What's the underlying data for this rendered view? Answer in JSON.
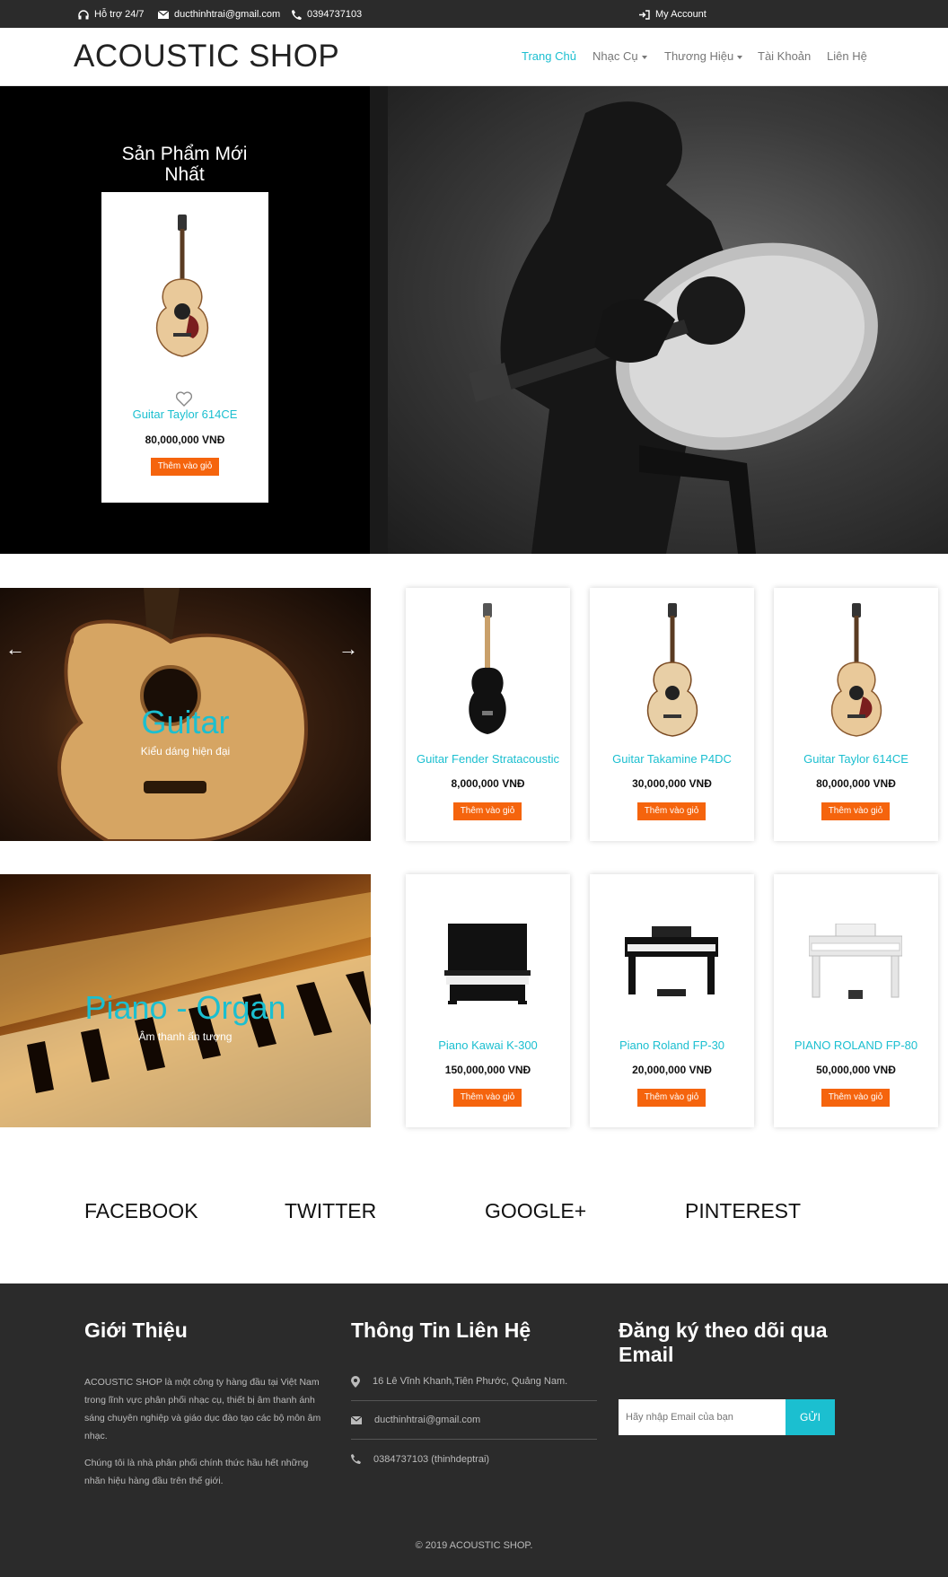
{
  "topbar": {
    "support": "Hỗ trợ 24/7",
    "email": "ducthinhtrai@gmail.com",
    "phone": "0394737103",
    "account": "My Account"
  },
  "brand": {
    "logo": "ACOUSTIC SHOP"
  },
  "nav": {
    "home": "Trang Chủ",
    "instruments": "Nhạc Cụ",
    "brands": "Thương Hiệu",
    "account": "Tài Khoản",
    "contact": "Liên Hệ"
  },
  "hero": {
    "new_title": "Sản Phẩm Mới Nhất",
    "product": {
      "name": "Guitar Taylor 614CE",
      "price": "80,000,000 VNĐ",
      "button": "Thêm vào giỏ"
    }
  },
  "banners": {
    "guitar": {
      "title": "Guitar",
      "subtitle": "Kiểu dáng hiện đại"
    },
    "piano": {
      "title": "Piano - Organ",
      "subtitle": "Âm thanh ấn tượng"
    }
  },
  "guitars": [
    {
      "name": "Guitar Fender Stratacoustic",
      "price": "8,000,000 VNĐ",
      "button": "Thêm vào giỏ"
    },
    {
      "name": "Guitar Takamine P4DC",
      "price": "30,000,000 VNĐ",
      "button": "Thêm vào giỏ"
    },
    {
      "name": "Guitar Taylor 614CE",
      "price": "80,000,000 VNĐ",
      "button": "Thêm vào giỏ"
    }
  ],
  "pianos": [
    {
      "name": "Piano Kawai K-300",
      "price": "150,000,000 VNĐ",
      "button": "Thêm vào giỏ"
    },
    {
      "name": "Piano Roland FP-30",
      "price": "20,000,000 VNĐ",
      "button": "Thêm vào giỏ"
    },
    {
      "name": "PIANO ROLAND FP-80",
      "price": "50,000,000 VNĐ",
      "button": "Thêm vào giỏ"
    }
  ],
  "social": [
    "FACEBOOK",
    "TWITTER",
    "GOOGLE+",
    "PINTEREST"
  ],
  "footer": {
    "about_title": "Giới Thiệu",
    "about_p1": "ACOUSTIC SHOP là một công ty hàng đầu tại Việt Nam trong lĩnh vực phân phối nhạc cụ, thiết bị âm thanh ánh sáng chuyên nghiệp và giáo dục đào tạo các bộ môn âm nhạc.",
    "about_p2": "Chúng tôi là nhà phân phối chính thức hầu hết những nhãn hiệu hàng đầu trên thế giới.",
    "contact_title": "Thông Tin Liên Hệ",
    "address": "16 Lê Vĩnh Khanh,Tiên Phước, Quảng Nam.",
    "email": "ducthinhtrai@gmail.com",
    "phone": "0384737103 (thinhdeptrai)",
    "subscribe_title": "Đăng ký theo dõi qua Email",
    "email_placeholder": "Hãy nhập Email của bạn",
    "submit": "GỬI",
    "copyright": "© 2019 ACOUSTIC SHOP."
  },
  "colors": {
    "accent": "#1bbfd0",
    "button": "#f5640d",
    "dark": "#2b2b2b"
  }
}
